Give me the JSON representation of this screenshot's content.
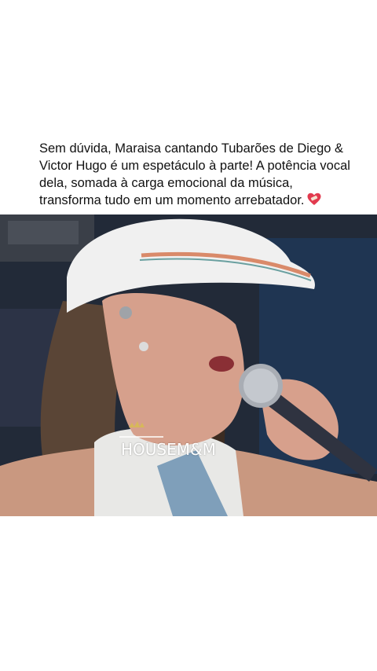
{
  "post": {
    "caption": "Sem dúvida, Maraisa cantando Tubarões de Diego & Victor Hugo é um espetáculo à parte! A potência vocal dela, somada à carga emocional da música, transforma tudo em um momento arrebatador.",
    "caption_emoji": "heart-with-bandage-icon",
    "video": {
      "content": "singer-with-white-cap-and-microphone",
      "watermark": "HOUSEM&M"
    }
  },
  "colors": {
    "background": "#ffffff",
    "text": "#111111",
    "cap": "#f2f2f2",
    "cap_stripe": "#d98a6a"
  }
}
